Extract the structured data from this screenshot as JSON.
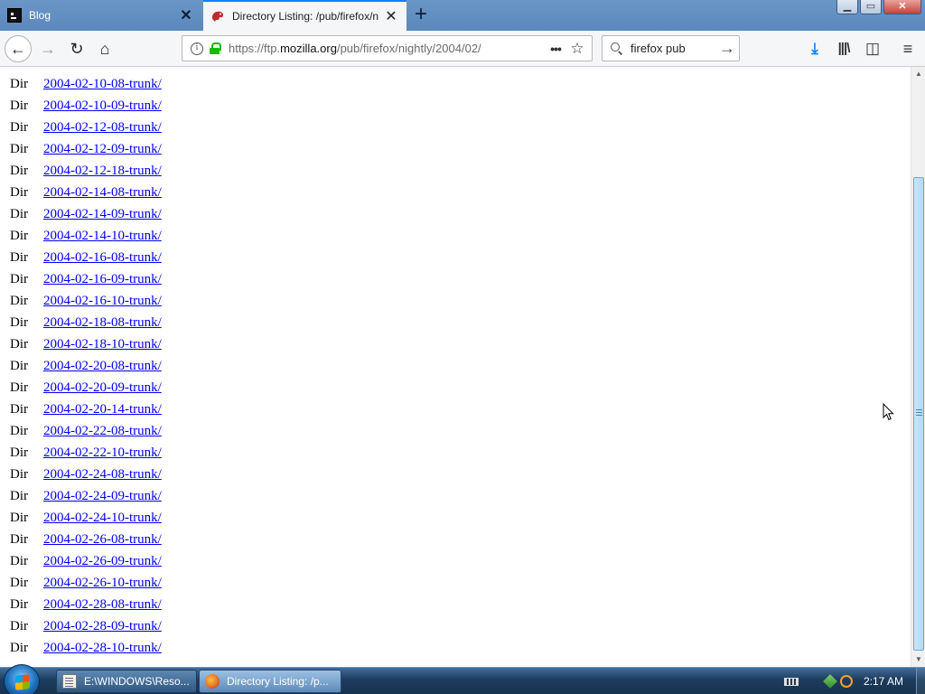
{
  "tabs": [
    {
      "title": "Blog",
      "close": "✕"
    },
    {
      "title": "Directory Listing: /pub/firefox/n",
      "close": "✕"
    }
  ],
  "new_tab": "+",
  "window_controls": {
    "minimize": "▁",
    "maximize": "▭",
    "close": "✕"
  },
  "nav": {
    "back": "←",
    "forward": "→",
    "reload": "↻",
    "home": "⌂"
  },
  "url": {
    "prefix": "https://ftp.",
    "host": "mozilla.org",
    "path": "/pub/firefox/nightly/2004/02/",
    "page_actions": "•••",
    "bookmark_star": "☆"
  },
  "search": {
    "value": "firefox pub",
    "go": "→"
  },
  "toolbar_icons": {
    "download": "⤓",
    "library": "|||\\",
    "sidebar": "◫",
    "menu": "≡"
  },
  "listing": [
    {
      "kind": "Dir",
      "name": "2004-02-10-08-trunk/"
    },
    {
      "kind": "Dir",
      "name": "2004-02-10-09-trunk/"
    },
    {
      "kind": "Dir",
      "name": "2004-02-12-08-trunk/"
    },
    {
      "kind": "Dir",
      "name": "2004-02-12-09-trunk/"
    },
    {
      "kind": "Dir",
      "name": "2004-02-12-18-trunk/"
    },
    {
      "kind": "Dir",
      "name": "2004-02-14-08-trunk/"
    },
    {
      "kind": "Dir",
      "name": "2004-02-14-09-trunk/"
    },
    {
      "kind": "Dir",
      "name": "2004-02-14-10-trunk/"
    },
    {
      "kind": "Dir",
      "name": "2004-02-16-08-trunk/"
    },
    {
      "kind": "Dir",
      "name": "2004-02-16-09-trunk/"
    },
    {
      "kind": "Dir",
      "name": "2004-02-16-10-trunk/"
    },
    {
      "kind": "Dir",
      "name": "2004-02-18-08-trunk/"
    },
    {
      "kind": "Dir",
      "name": "2004-02-18-10-trunk/"
    },
    {
      "kind": "Dir",
      "name": "2004-02-20-08-trunk/"
    },
    {
      "kind": "Dir",
      "name": "2004-02-20-09-trunk/"
    },
    {
      "kind": "Dir",
      "name": "2004-02-20-14-trunk/"
    },
    {
      "kind": "Dir",
      "name": "2004-02-22-08-trunk/"
    },
    {
      "kind": "Dir",
      "name": "2004-02-22-10-trunk/"
    },
    {
      "kind": "Dir",
      "name": "2004-02-24-08-trunk/"
    },
    {
      "kind": "Dir",
      "name": "2004-02-24-09-trunk/"
    },
    {
      "kind": "Dir",
      "name": "2004-02-24-10-trunk/"
    },
    {
      "kind": "Dir",
      "name": "2004-02-26-08-trunk/"
    },
    {
      "kind": "Dir",
      "name": "2004-02-26-09-trunk/"
    },
    {
      "kind": "Dir",
      "name": "2004-02-26-10-trunk/"
    },
    {
      "kind": "Dir",
      "name": "2004-02-28-08-trunk/"
    },
    {
      "kind": "Dir",
      "name": "2004-02-28-09-trunk/"
    },
    {
      "kind": "Dir",
      "name": "2004-02-28-10-trunk/"
    }
  ],
  "scrollbar": {
    "up": "▲",
    "down": "▼"
  },
  "taskbar": {
    "tasks": [
      {
        "label": "E:\\WINDOWS\\Reso..."
      },
      {
        "label": "Directory Listing: /p..."
      }
    ],
    "clock": "2:17 AM"
  },
  "colors": {
    "link": "#0000ee",
    "tab_accent": "#0a84ff",
    "secure_lock": "#12bc00",
    "titlebar": "#5a88bd",
    "taskbar": "#1d3c5e"
  }
}
